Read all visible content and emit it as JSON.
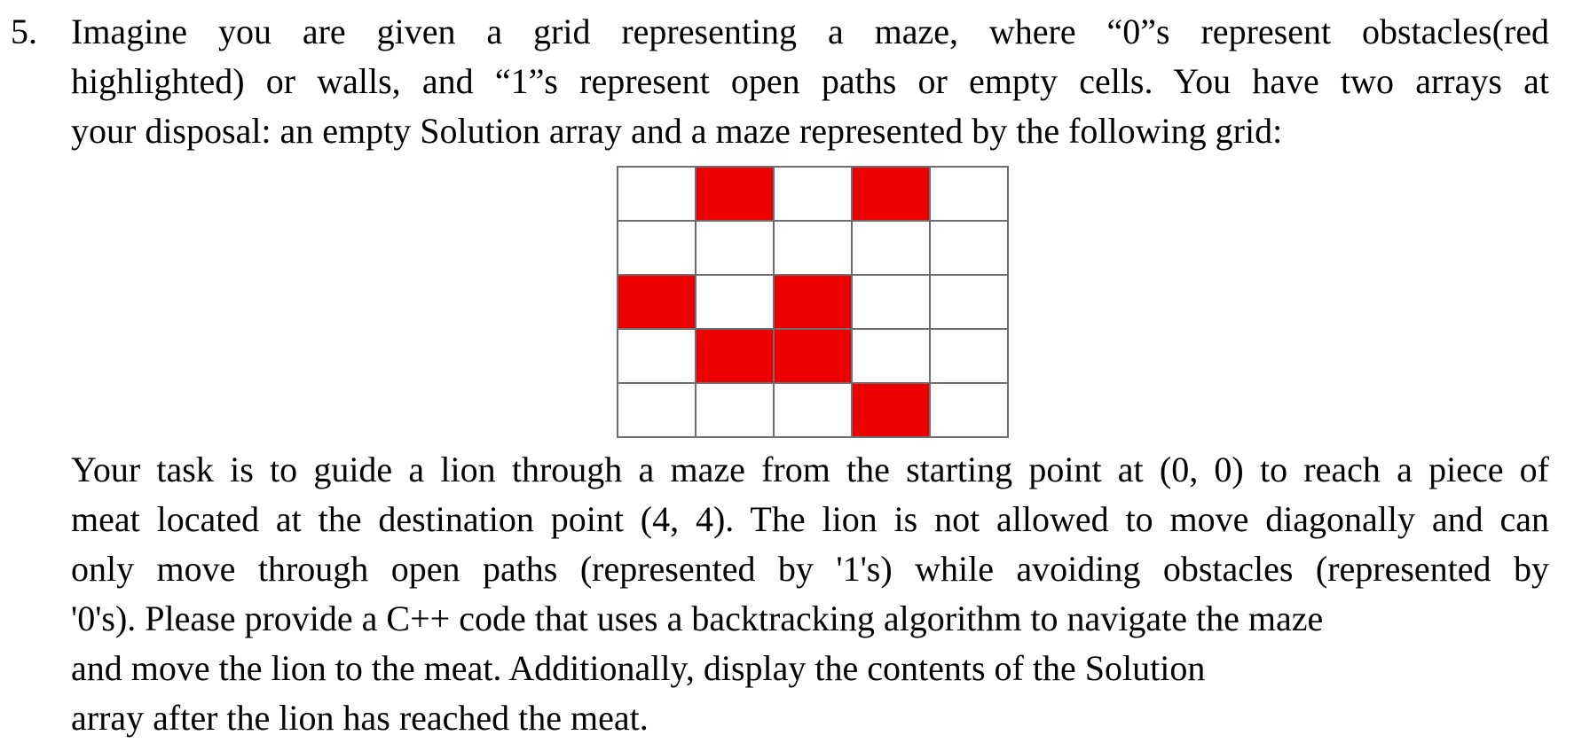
{
  "question": {
    "number": "5.",
    "intro_lines": [
      "Imagine you are given a grid representing a maze, where “0”s represent obstacles(red",
      "highlighted) or walls, and “1”s represent open paths or empty cells. You have two arrays at",
      "your disposal: an empty Solution array and a maze represented by the following grid:"
    ],
    "task_lines": [
      "Your task is to guide a lion through a maze from the starting point at (0, 0) to reach a piece of",
      "meat located at the destination point (4, 4). The lion is not allowed to move diagonally and can",
      "only move through open paths (represented by '1's) while avoiding obstacles (represented by",
      "'0's). Please provide a C++ code that uses a backtracking algorithm to navigate the maze",
      "and move the lion to the meat. Additionally, display the contents of the Solution",
      "array after the lion has reached the meat."
    ]
  },
  "maze": {
    "wall_color": "#ee0000",
    "open_color": "#ffffff",
    "rows": [
      [
        1,
        0,
        1,
        0,
        1
      ],
      [
        1,
        1,
        1,
        1,
        1
      ],
      [
        0,
        1,
        0,
        1,
        1
      ],
      [
        1,
        0,
        0,
        1,
        1
      ],
      [
        1,
        1,
        1,
        0,
        1
      ]
    ]
  }
}
